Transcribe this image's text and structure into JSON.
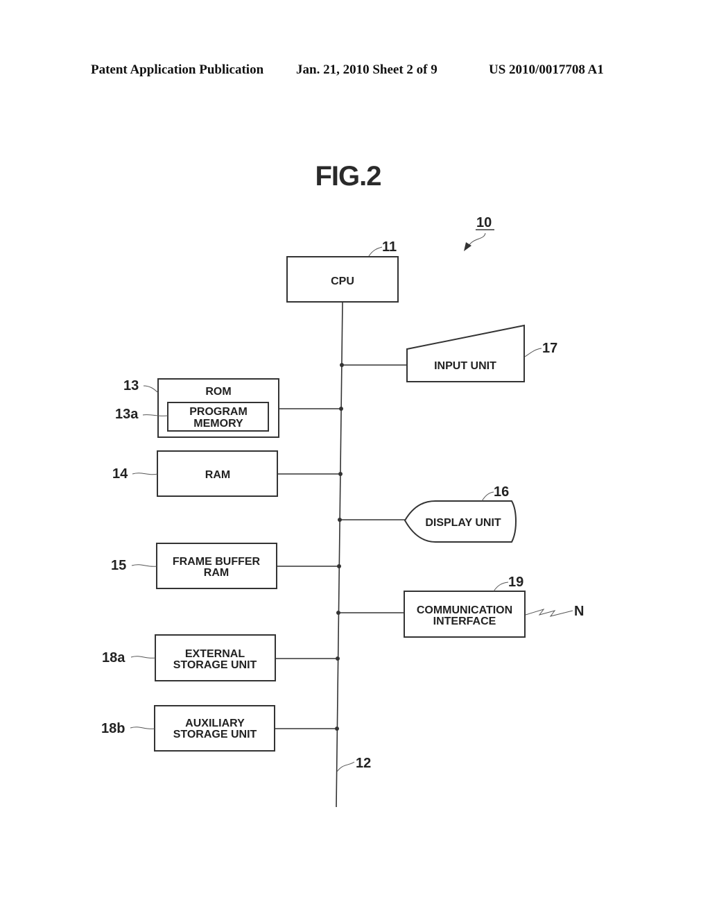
{
  "header": {
    "publication": "Patent Application Publication",
    "date_sheet": "Jan. 21, 2010  Sheet 2 of 9",
    "number": "US 2010/0017708 A1"
  },
  "figure": {
    "title": "FIG.2",
    "system_ref": "10",
    "bus_ref": "12",
    "blocks": {
      "cpu": {
        "ref": "11",
        "label": [
          "CPU"
        ]
      },
      "rom": {
        "ref": "13",
        "label": [
          "ROM"
        ]
      },
      "program_memory": {
        "ref": "13a",
        "label": [
          "PROGRAM",
          "MEMORY"
        ]
      },
      "ram": {
        "ref": "14",
        "label": [
          "RAM"
        ]
      },
      "frame_buffer": {
        "ref": "15",
        "label": [
          "FRAME BUFFER",
          "RAM"
        ]
      },
      "display": {
        "ref": "16",
        "label": [
          "DISPLAY UNIT"
        ]
      },
      "input": {
        "ref": "17",
        "label": [
          "INPUT UNIT"
        ]
      },
      "external_storage": {
        "ref": "18a",
        "label": [
          "EXTERNAL",
          "STORAGE UNIT"
        ]
      },
      "auxiliary_storage": {
        "ref": "18b",
        "label": [
          "AUXILIARY",
          "STORAGE UNIT"
        ]
      },
      "comm": {
        "ref": "19",
        "label": [
          "COMMUNICATION",
          "INTERFACE"
        ]
      }
    },
    "network_label": "N"
  }
}
